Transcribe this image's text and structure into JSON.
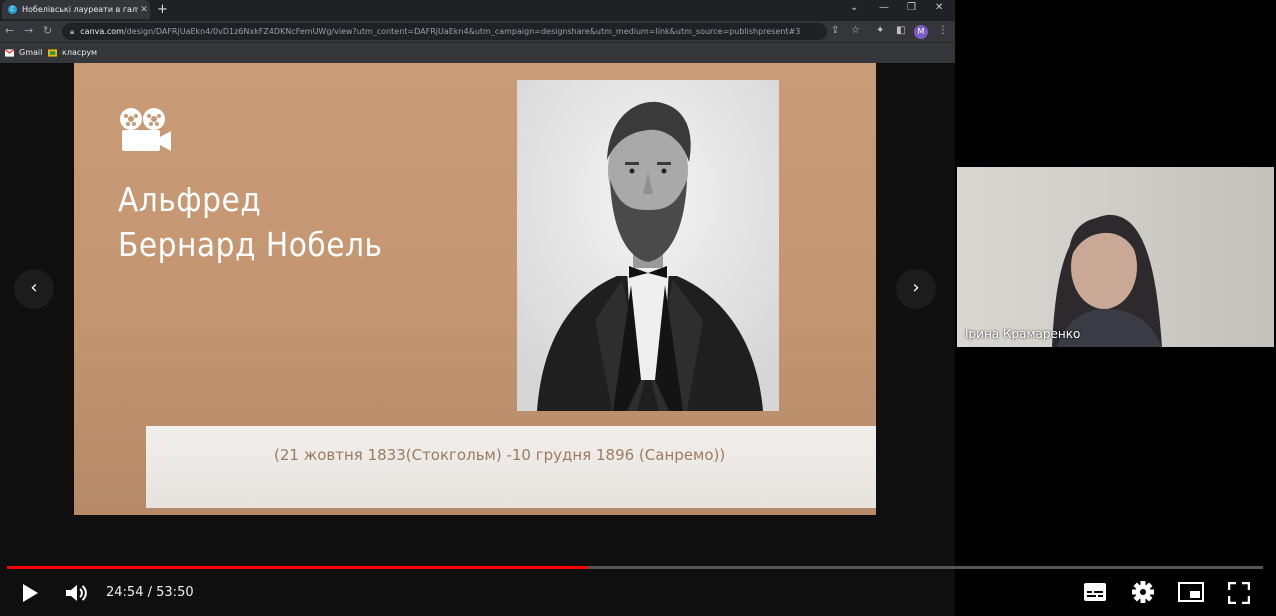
{
  "browser": {
    "tab_title": "Нобелівські лауреати в галузі е",
    "favicon_letter": "C",
    "url_host": "canva.com",
    "url_path": "/design/DAFRjUaEkn4/0vD1z6NxkFZ4DKNcFemUWg/view?utm_content=DAFRjUaEkn4&utm_campaign=designshare&utm_medium=link&utm_source=publishpresent#3",
    "profile_initial": "M",
    "bookmarks": [
      {
        "label": "Gmail"
      },
      {
        "label": "класрум"
      }
    ]
  },
  "slide": {
    "title_line1": "Альфред",
    "title_line2": "Бернард Нобель",
    "caption": "(21 жовтня 1833(Стокгольм) -10 грудня 1896 (Санремо))",
    "background_color": "#c69a75"
  },
  "webcam": {
    "participant_name": "Ірина Крамаренко"
  },
  "player": {
    "current_time": "24:54",
    "separator": "/",
    "duration": "53:50",
    "progress_fraction": 0.4625,
    "accent_color": "#ff0000"
  }
}
